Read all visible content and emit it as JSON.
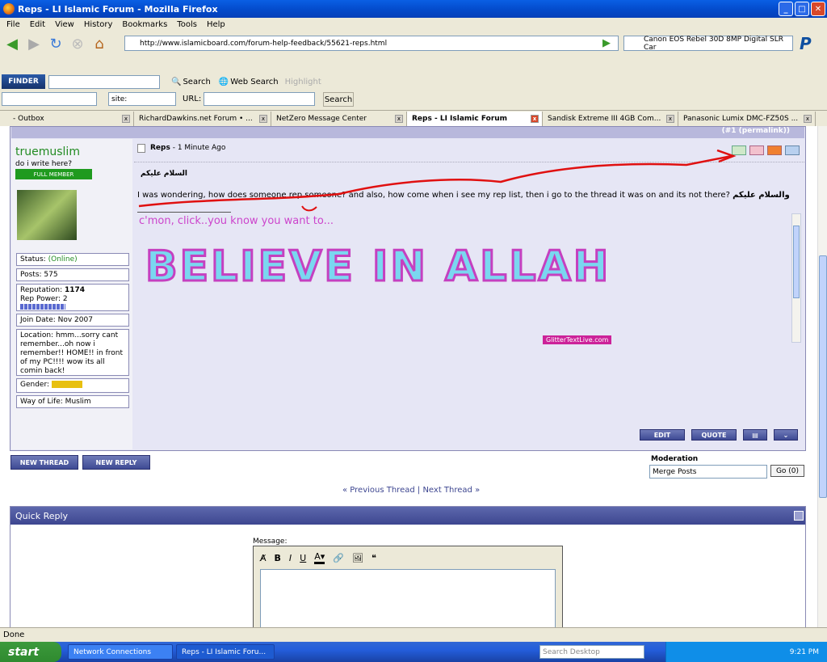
{
  "window": {
    "title": "Reps - LI Islamic Forum - Mozilla Firefox"
  },
  "menu": [
    "File",
    "Edit",
    "View",
    "History",
    "Bookmarks",
    "Tools",
    "Help"
  ],
  "nav": {
    "url": "http://www.islamicboard.com/forum-help-feedback/55621-reps.html",
    "search_value": "Canon EOS Rebel 30D 8MP Digital SLR Car"
  },
  "finder": {
    "logo": "FINDER",
    "search_label": "Search",
    "web_search_label": "Web Search",
    "highlight_label": "Highlight",
    "site_label": "site:",
    "url_label": "URL:",
    "search_button": "Search"
  },
  "tabs": [
    {
      "label": "- Outbox"
    },
    {
      "label": "RichardDawkins.net Forum • ..."
    },
    {
      "label": "NetZero Message Center"
    },
    {
      "label": "Reps - LI Islamic Forum"
    },
    {
      "label": "Sandisk Extreme III 4GB Com..."
    },
    {
      "label": "Panasonic Lumix DMC-FZ50S ..."
    }
  ],
  "post": {
    "permalink": "(#1 (permalink))",
    "username": "truemuslim",
    "user_title": "do i write here?",
    "rank": "FULL MEMBER",
    "status_label": "Status:",
    "status_value": "(Online)",
    "posts": "Posts: 575",
    "reputation_label": "Reputation:",
    "reputation_value": "1174",
    "rep_power": "Rep Power: 2",
    "join_date": "Join Date: Nov 2007",
    "location": "Location: hmm...sorry cant remember...oh now i remember!! HOME!! in front of my PC!!!! wow its all comin back!",
    "gender_label": "Gender:",
    "way_of_life": "Way of Life: Muslim",
    "title": "Reps",
    "time": "- 1 Minute Ago",
    "greeting": "السلام عليكم",
    "body": "I was wondering, how does someone rep someone? and also, how come when i see my rep list, then i go to the thread it was on and its not there?",
    "body_end": "والسلام عليكم",
    "sig_text": "c'mon, click..you know you want to...",
    "sig_image": "BELIEVE IN ALLAH",
    "glitter": "GlitterTextLive.com",
    "buttons": {
      "edit": "EDIT",
      "quote": "QUOTE"
    }
  },
  "actions": {
    "new_thread": "NEW THREAD",
    "new_reply": "NEW REPLY",
    "moderation_label": "Moderation",
    "moderation_select": "Merge Posts",
    "go_button": "Go (0)"
  },
  "thread_nav": {
    "prev": "« Previous Thread",
    "sep": "|",
    "next": "Next Thread »"
  },
  "quick_reply": {
    "title": "Quick Reply",
    "message_label": "Message:"
  },
  "statusbar": {
    "text": "Done"
  },
  "taskbar": {
    "start": "start",
    "items": [
      "Network Connections",
      "Reps - LI Islamic Foru..."
    ],
    "search_placeholder": "Search Desktop",
    "clock": "9:21 PM"
  },
  "colors": {
    "accent": "#3d4690",
    "username": "#228b22",
    "online": "#228b22",
    "annotation": "#e01010",
    "signature": "#cc44cc"
  }
}
